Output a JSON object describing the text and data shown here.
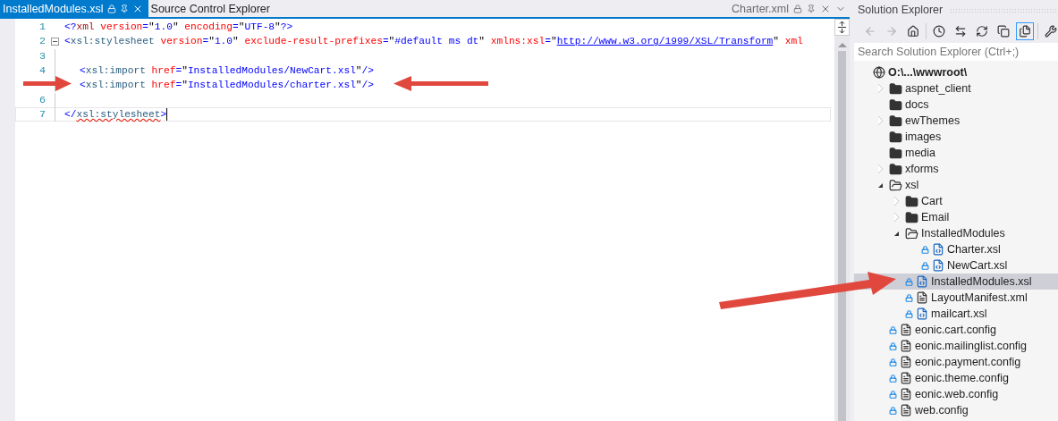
{
  "editor": {
    "tab": {
      "title": "InstalledModules.xsl",
      "selected": true
    },
    "tabs": [
      {
        "title": "Source Control Explorer",
        "selected": false
      }
    ],
    "preview_tab": {
      "title": "Charter.xml"
    },
    "lines": [
      {
        "number": "1",
        "tokens": [
          {
            "kind": "delim",
            "text": "<?"
          },
          {
            "kind": "tag",
            "text": "xml"
          },
          {
            "kind": "attr",
            "text": " version"
          },
          {
            "kind": "delim",
            "text": "="
          },
          {
            "kind": "plain",
            "text": "\""
          },
          {
            "kind": "value",
            "text": "1.0"
          },
          {
            "kind": "plain",
            "text": "\""
          },
          {
            "kind": "attr",
            "text": " encoding"
          },
          {
            "kind": "delim",
            "text": "="
          },
          {
            "kind": "plain",
            "text": "\""
          },
          {
            "kind": "value",
            "text": "UTF-8"
          },
          {
            "kind": "plain",
            "text": "\""
          },
          {
            "kind": "delim",
            "text": "?>"
          }
        ]
      },
      {
        "number": "2",
        "fold": true,
        "tokens": [
          {
            "kind": "delim",
            "text": "<"
          },
          {
            "kind": "element",
            "text": "xsl:stylesheet"
          },
          {
            "kind": "attr",
            "text": " version"
          },
          {
            "kind": "delim",
            "text": "="
          },
          {
            "kind": "plain",
            "text": "\""
          },
          {
            "kind": "value",
            "text": "1.0"
          },
          {
            "kind": "plain",
            "text": "\""
          },
          {
            "kind": "attr",
            "text": " exclude-result-prefixes"
          },
          {
            "kind": "delim",
            "text": "="
          },
          {
            "kind": "plain",
            "text": "\""
          },
          {
            "kind": "value",
            "text": "#default ms dt"
          },
          {
            "kind": "plain",
            "text": "\""
          },
          {
            "kind": "attr",
            "text": " xmlns:xsl"
          },
          {
            "kind": "delim",
            "text": "="
          },
          {
            "kind": "plain",
            "text": "\""
          },
          {
            "kind": "link",
            "text": "http://www.w3.org/1999/XSL/Transform"
          },
          {
            "kind": "plain",
            "text": "\""
          },
          {
            "kind": "attr",
            "text": " xml"
          }
        ]
      },
      {
        "number": "3"
      },
      {
        "number": "4",
        "indented": true,
        "tokens": [
          {
            "kind": "delim",
            "text": "<"
          },
          {
            "kind": "element",
            "text": "xsl:import"
          },
          {
            "kind": "attr",
            "text": " href"
          },
          {
            "kind": "delim",
            "text": "="
          },
          {
            "kind": "plain",
            "text": "\""
          },
          {
            "kind": "value",
            "text": "InstalledModules/NewCart.xsl"
          },
          {
            "kind": "plain",
            "text": "\""
          },
          {
            "kind": "delim",
            "text": "/>"
          }
        ]
      },
      {
        "indented": true,
        "tokens": [
          {
            "kind": "delim",
            "text": "<"
          },
          {
            "kind": "element",
            "text": "xsl:import"
          },
          {
            "kind": "attr",
            "text": " href"
          },
          {
            "kind": "delim",
            "text": "="
          },
          {
            "kind": "plain",
            "text": "\""
          },
          {
            "kind": "value",
            "text": "InstalledModules/charter.xsl"
          },
          {
            "kind": "plain",
            "text": "\""
          },
          {
            "kind": "delim",
            "text": "/>"
          }
        ]
      },
      {
        "number": "6"
      },
      {
        "number": "7",
        "current": true,
        "tokens": [
          {
            "kind": "delim",
            "text": "</"
          },
          {
            "kind": "element",
            "text": "xsl:stylesheet",
            "squiggle": true
          },
          {
            "kind": "delim",
            "text": ">"
          }
        ]
      }
    ]
  },
  "solution_explorer": {
    "title": "Solution Explorer",
    "search": {
      "placeholder": "Search Solution Explorer (Ctrl+;)"
    },
    "tree": [
      {
        "label": "O:\\...\\wwwroot\\",
        "kind": "root",
        "selected": false,
        "children": [
          {
            "label": "aspnet_client",
            "kind": "folder",
            "expanded": false,
            "selected": false
          },
          {
            "label": "docs",
            "kind": "folder",
            "selected": false
          },
          {
            "label": "ewThemes",
            "kind": "folder",
            "expanded": false,
            "selected": false
          },
          {
            "label": "images",
            "kind": "folder",
            "selected": false
          },
          {
            "label": "media",
            "kind": "folder",
            "selected": false
          },
          {
            "label": "xforms",
            "kind": "folder",
            "expanded": false,
            "selected": false
          },
          {
            "label": "xsl",
            "kind": "folder",
            "expanded": true,
            "selected": false,
            "children": [
              {
                "label": "Cart",
                "kind": "folder",
                "expanded": false,
                "selected": false
              },
              {
                "label": "Email",
                "kind": "folder",
                "expanded": false,
                "selected": false
              },
              {
                "label": "InstalledModules",
                "kind": "folder",
                "expanded": true,
                "selected": false,
                "children": [
                  {
                    "label": "Charter.xsl",
                    "kind": "xsl",
                    "selected": false
                  },
                  {
                    "label": "NewCart.xsl",
                    "kind": "xsl",
                    "selected": false
                  }
                ]
              },
              {
                "label": "InstalledModules.xsl",
                "kind": "xsl",
                "selected": true
              },
              {
                "label": "LayoutManifest.xml",
                "kind": "xml",
                "selected": false
              },
              {
                "label": "mailcart.xsl",
                "kind": "xsl",
                "selected": false
              }
            ]
          },
          {
            "label": "eonic.cart.config",
            "kind": "config",
            "selected": false
          },
          {
            "label": "eonic.mailinglist.config",
            "kind": "config",
            "selected": false
          },
          {
            "label": "eonic.payment.config",
            "kind": "config",
            "selected": false
          },
          {
            "label": "eonic.theme.config",
            "kind": "config",
            "selected": false
          },
          {
            "label": "eonic.web.config",
            "kind": "config",
            "selected": false
          },
          {
            "label": "web.config",
            "kind": "config",
            "selected": false
          }
        ]
      }
    ]
  }
}
